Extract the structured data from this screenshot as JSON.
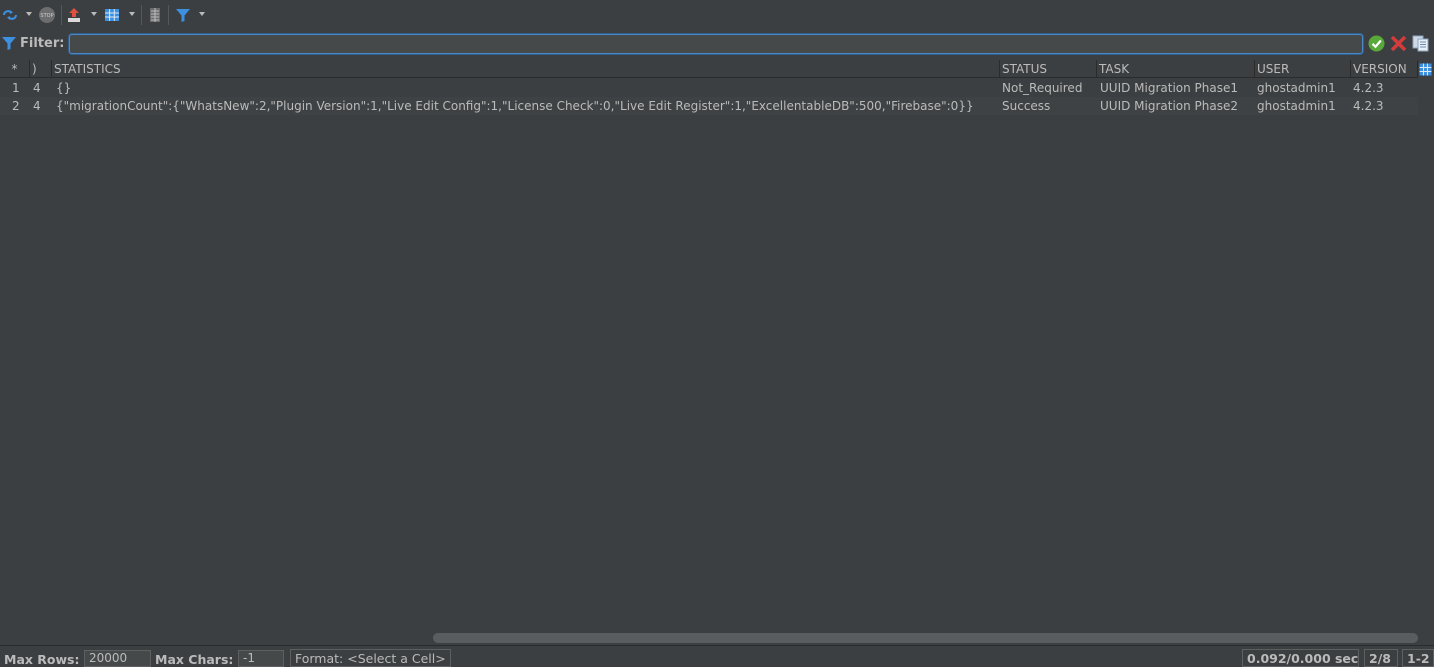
{
  "toolbar": {
    "icons": [
      "refresh-icon",
      "stop-icon",
      "export-icon",
      "grid-view-icon",
      "record-view-icon",
      "filter-icon"
    ],
    "stop_text": "STOP"
  },
  "filter": {
    "label": "Filter:",
    "value": "",
    "placeholder": ""
  },
  "colors": {
    "background": "#3c3f41",
    "text": "#bbbbbb",
    "accent_blue": "#3d8fe0",
    "ok_green": "#59a83a",
    "cancel_red": "#d43b3b"
  },
  "table": {
    "columns": [
      "*",
      "ID",
      "STATISTICS",
      "STATUS",
      "TASK",
      "USER",
      "VERSION"
    ],
    "header_visible": [
      "*",
      ")",
      "STATISTICS",
      "STATUS",
      "TASK",
      "USER",
      "VERSION"
    ],
    "rows": [
      {
        "rownum": "1",
        "id": "4",
        "statistics": "{}",
        "status": "Not_Required",
        "task": "UUID Migration Phase1",
        "user": "ghostadmin1",
        "version": "4.2.3"
      },
      {
        "rownum": "2",
        "id": "4",
        "statistics": "{\"migrationCount\":{\"WhatsNew\":2,\"Plugin Version\":1,\"Live Edit Config\":1,\"License Check\":0,\"Live Edit Register\":1,\"ExcellentableDB\":500,\"Firebase\":0}}",
        "status": "Success",
        "task": "UUID Migration Phase2",
        "user": "ghostadmin1",
        "version": "4.2.3"
      }
    ]
  },
  "status": {
    "max_rows_label": "Max Rows:",
    "max_rows_value": "20000",
    "max_chars_label": "Max Chars:",
    "max_chars_value": "-1",
    "format_text": "Format: <Select a Cell>",
    "timing": "0.092/0.000 sec",
    "fetched": "2/8",
    "range": "1-2"
  }
}
